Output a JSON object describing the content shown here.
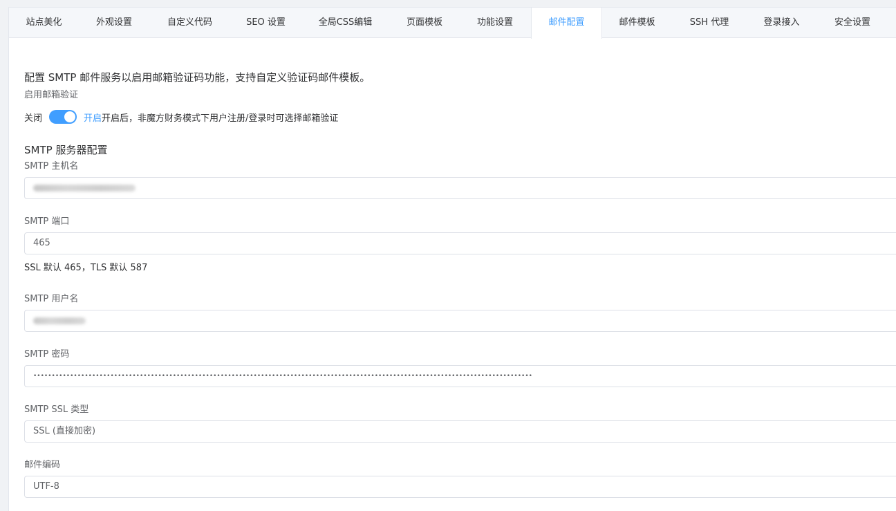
{
  "tabs": [
    {
      "label": "站点美化"
    },
    {
      "label": "外观设置"
    },
    {
      "label": "自定义代码"
    },
    {
      "label": "SEO 设置"
    },
    {
      "label": "全局CSS编辑"
    },
    {
      "label": "页面模板"
    },
    {
      "label": "功能设置"
    },
    {
      "label": "邮件配置",
      "active": true
    },
    {
      "label": "邮件模板"
    },
    {
      "label": "SSH 代理"
    },
    {
      "label": "登录接入"
    },
    {
      "label": "安全设置"
    }
  ],
  "intro": "配置 SMTP 邮件服务以启用邮箱验证码功能，支持自定义验证码邮件模板。",
  "email_verify": {
    "label": "启用邮箱验证",
    "off_label": "关闭",
    "on_label": "开启",
    "description": "开启后，非魔方财务模式下用户注册/登录时可选择邮箱验证",
    "enabled": true
  },
  "smtp_section_title": "SMTP 服务器配置",
  "fields": {
    "host": {
      "label": "SMTP 主机名",
      "value": ""
    },
    "port": {
      "label": "SMTP 端口",
      "value": "465",
      "hint": "SSL 默认 465，TLS 默认 587"
    },
    "username": {
      "label": "SMTP 用户名",
      "value": ""
    },
    "password": {
      "label": "SMTP 密码",
      "value": "••••••••••••••••••••••••••••••••••••••••••••••••••••••••••••••••••••••••••••••••••••••••••••••••••••••••••••••••••••••••••••••••••••••••"
    },
    "ssl_type": {
      "label": "SMTP SSL 类型",
      "value": "SSL (直接加密)"
    },
    "encoding": {
      "label": "邮件编码",
      "value": "UTF-8"
    }
  },
  "colors": {
    "accent": "#409eff",
    "border": "#dcdfe6"
  }
}
